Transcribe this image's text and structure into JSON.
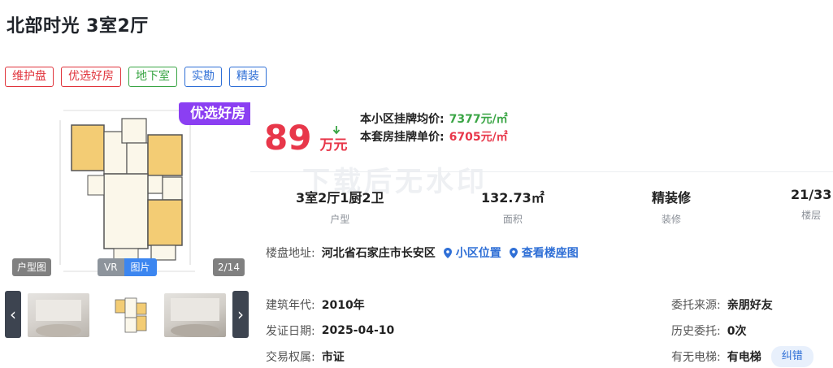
{
  "title": "北部时光 3室2厅",
  "tags": [
    {
      "label": "维护盘",
      "color": "red"
    },
    {
      "label": "优选好房",
      "color": "red"
    },
    {
      "label": "地下室",
      "color": "green"
    },
    {
      "label": "实勘",
      "color": "blue"
    },
    {
      "label": "精装",
      "color": "blue"
    }
  ],
  "gallery": {
    "badge": "优选好房",
    "huxing_label": "户型图",
    "vr_label": "VR",
    "pic_label": "图片",
    "counter": "2/14",
    "thumbnails": 3,
    "prev_icon": "chevron-left-icon",
    "next_icon": "chevron-right-icon"
  },
  "price": {
    "amount": "89",
    "unit": "万元",
    "community_avg_label": "本小区挂牌均价:",
    "community_avg_value": "7377元/㎡",
    "listing_unit_label": "本套房挂牌单价:",
    "listing_unit_value": "6705元/㎡",
    "trend_icon": "arrow-down-icon"
  },
  "stats": [
    {
      "value": "3室2厅1厨2卫",
      "label": "户型"
    },
    {
      "value": "132.73㎡",
      "label": "面积"
    },
    {
      "value": "精装修",
      "label": "装修"
    },
    {
      "value": "21/33",
      "label": "楼层"
    }
  ],
  "address": {
    "label": "楼盘地址:",
    "value": "河北省石家庄市长安区",
    "link_location": "小区位置",
    "link_building": "查看楼座图"
  },
  "details": {
    "year_label": "建筑年代:",
    "year_value": "2010年",
    "cert_label": "发证日期:",
    "cert_value": "2025-04-10",
    "rights_label": "交易权属:",
    "rights_value": "市证",
    "source_label": "委托来源:",
    "source_value": "亲朋好友",
    "history_label": "历史委托:",
    "history_value": "0次",
    "elevator_label": "有无电梯:",
    "elevator_value": "有电梯",
    "correct_label": "纠错"
  },
  "watermark": "下载后无水印",
  "colors": {
    "price": "#e8374a",
    "green": "#3aa545",
    "blue": "#2f6fd6",
    "purple": "#8b3ff2"
  }
}
